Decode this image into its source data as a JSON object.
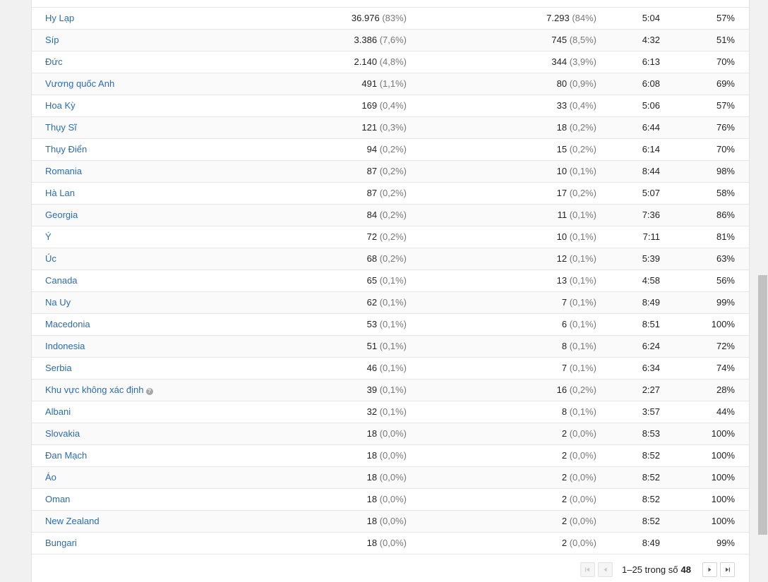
{
  "table": {
    "rows": [
      {
        "country": "Hy Lạp",
        "users": "36.976",
        "users_pct": "(83%)",
        "new_users": "7.293",
        "new_users_pct": "(84%)",
        "duration": "5:04",
        "rate": "57%"
      },
      {
        "country": "Síp",
        "users": "3.386",
        "users_pct": "(7,6%)",
        "new_users": "745",
        "new_users_pct": "(8,5%)",
        "duration": "4:32",
        "rate": "51%"
      },
      {
        "country": "Đức",
        "users": "2.140",
        "users_pct": "(4,8%)",
        "new_users": "344",
        "new_users_pct": "(3,9%)",
        "duration": "6:13",
        "rate": "70%"
      },
      {
        "country": "Vương quốc Anh",
        "users": "491",
        "users_pct": "(1,1%)",
        "new_users": "80",
        "new_users_pct": "(0,9%)",
        "duration": "6:08",
        "rate": "69%"
      },
      {
        "country": "Hoa Kỳ",
        "users": "169",
        "users_pct": "(0,4%)",
        "new_users": "33",
        "new_users_pct": "(0,4%)",
        "duration": "5:06",
        "rate": "57%"
      },
      {
        "country": "Thụy Sĩ",
        "users": "121",
        "users_pct": "(0,3%)",
        "new_users": "18",
        "new_users_pct": "(0,2%)",
        "duration": "6:44",
        "rate": "76%"
      },
      {
        "country": "Thụy Điển",
        "users": "94",
        "users_pct": "(0,2%)",
        "new_users": "15",
        "new_users_pct": "(0,2%)",
        "duration": "6:14",
        "rate": "70%"
      },
      {
        "country": "Romania",
        "users": "87",
        "users_pct": "(0,2%)",
        "new_users": "10",
        "new_users_pct": "(0,1%)",
        "duration": "8:44",
        "rate": "98%"
      },
      {
        "country": "Hà Lan",
        "users": "87",
        "users_pct": "(0,2%)",
        "new_users": "17",
        "new_users_pct": "(0,2%)",
        "duration": "5:07",
        "rate": "58%"
      },
      {
        "country": "Georgia",
        "users": "84",
        "users_pct": "(0,2%)",
        "new_users": "11",
        "new_users_pct": "(0,1%)",
        "duration": "7:36",
        "rate": "86%"
      },
      {
        "country": "Ý",
        "users": "72",
        "users_pct": "(0,2%)",
        "new_users": "10",
        "new_users_pct": "(0,1%)",
        "duration": "7:11",
        "rate": "81%"
      },
      {
        "country": "Úc",
        "users": "68",
        "users_pct": "(0,2%)",
        "new_users": "12",
        "new_users_pct": "(0,1%)",
        "duration": "5:39",
        "rate": "63%"
      },
      {
        "country": "Canada",
        "users": "65",
        "users_pct": "(0,1%)",
        "new_users": "13",
        "new_users_pct": "(0,1%)",
        "duration": "4:58",
        "rate": "56%"
      },
      {
        "country": "Na Uy",
        "users": "62",
        "users_pct": "(0,1%)",
        "new_users": "7",
        "new_users_pct": "(0,1%)",
        "duration": "8:49",
        "rate": "99%"
      },
      {
        "country": "Macedonia",
        "users": "53",
        "users_pct": "(0,1%)",
        "new_users": "6",
        "new_users_pct": "(0,1%)",
        "duration": "8:51",
        "rate": "100%"
      },
      {
        "country": "Indonesia",
        "users": "51",
        "users_pct": "(0,1%)",
        "new_users": "8",
        "new_users_pct": "(0,1%)",
        "duration": "6:24",
        "rate": "72%"
      },
      {
        "country": "Serbia",
        "users": "46",
        "users_pct": "(0,1%)",
        "new_users": "7",
        "new_users_pct": "(0,1%)",
        "duration": "6:34",
        "rate": "74%"
      },
      {
        "country": "Khu vực không xác định",
        "users": "39",
        "users_pct": "(0,1%)",
        "new_users": "16",
        "new_users_pct": "(0,2%)",
        "duration": "2:27",
        "rate": "28%",
        "help_icon": "question-circle-icon"
      },
      {
        "country": "Albani",
        "users": "32",
        "users_pct": "(0,1%)",
        "new_users": "8",
        "new_users_pct": "(0,1%)",
        "duration": "3:57",
        "rate": "44%"
      },
      {
        "country": "Slovakia",
        "users": "18",
        "users_pct": "(0,0%)",
        "new_users": "2",
        "new_users_pct": "(0,0%)",
        "duration": "8:53",
        "rate": "100%"
      },
      {
        "country": "Đan Mạch",
        "users": "18",
        "users_pct": "(0,0%)",
        "new_users": "2",
        "new_users_pct": "(0,0%)",
        "duration": "8:52",
        "rate": "100%"
      },
      {
        "country": "Áo",
        "users": "18",
        "users_pct": "(0,0%)",
        "new_users": "2",
        "new_users_pct": "(0,0%)",
        "duration": "8:52",
        "rate": "100%"
      },
      {
        "country": "Oman",
        "users": "18",
        "users_pct": "(0,0%)",
        "new_users": "2",
        "new_users_pct": "(0,0%)",
        "duration": "8:52",
        "rate": "100%"
      },
      {
        "country": "New Zealand",
        "users": "18",
        "users_pct": "(0,0%)",
        "new_users": "2",
        "new_users_pct": "(0,0%)",
        "duration": "8:52",
        "rate": "100%"
      },
      {
        "country": "Bungari",
        "users": "18",
        "users_pct": "(0,0%)",
        "new_users": "2",
        "new_users_pct": "(0,0%)",
        "duration": "8:49",
        "rate": "99%"
      }
    ]
  },
  "pager": {
    "range": "1–25 trong số",
    "total": "48",
    "first_icon": "first-page-icon",
    "prev_icon": "prev-page-icon",
    "next_icon": "next-page-icon",
    "last_icon": "last-page-icon"
  },
  "colors": {
    "link": "#2b6cb0",
    "muted": "#777777",
    "row_alt": "#fafafa",
    "border": "#e6e6e6"
  }
}
